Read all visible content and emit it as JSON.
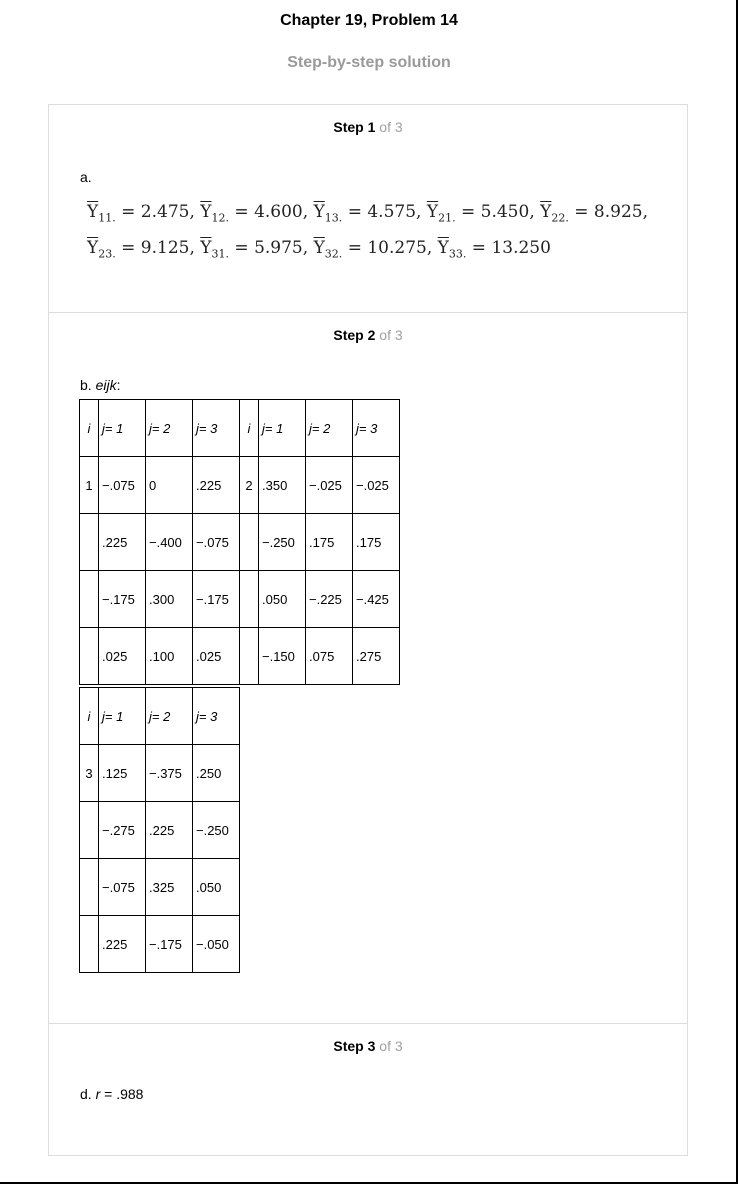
{
  "header": {
    "title": "Chapter 19, Problem 14",
    "subtitle": "Step-by-step solution"
  },
  "steps": [
    {
      "word": "Step",
      "number": "1",
      "of_text": "of 3",
      "part_label": "a.",
      "means": [
        {
          "sub": "11.",
          "value": "2.475"
        },
        {
          "sub": "12.",
          "value": "4.600"
        },
        {
          "sub": "13.",
          "value": "4.575"
        },
        {
          "sub": "21.",
          "value": "5.450"
        },
        {
          "sub": "22.",
          "value": "8.925"
        },
        {
          "sub": "23.",
          "value": "9.125"
        },
        {
          "sub": "31.",
          "value": "5.975"
        },
        {
          "sub": "32.",
          "value": "10.275"
        },
        {
          "sub": "33.",
          "value": "13.250"
        }
      ]
    },
    {
      "word": "Step",
      "number": "2",
      "of_text": "of 3",
      "part_label_prefix": "b. ",
      "part_label_italic": "eijk",
      "part_label_suffix": ":",
      "table_top": {
        "header": [
          "i",
          "j= 1",
          "j= 2",
          "j= 3",
          "i",
          "j= 1",
          "j= 2",
          "j= 3"
        ],
        "rows": [
          [
            "1",
            "−.075",
            "0",
            ".225",
            "2",
            ".350",
            "−.025",
            "−.025"
          ],
          [
            "",
            ".225",
            "−.400",
            "−.075",
            "",
            "−.250",
            ".175",
            ".175"
          ],
          [
            "",
            "−.175",
            ".300",
            "−.175",
            "",
            ".050",
            "−.225",
            "−.425"
          ],
          [
            "",
            ".025",
            ".100",
            ".025",
            "",
            "−.150",
            ".075",
            ".275"
          ]
        ]
      },
      "table_bottom": {
        "header": [
          "i",
          "j= 1",
          "j= 2",
          "j= 3"
        ],
        "rows": [
          [
            "3",
            ".125",
            "−.375",
            ".250"
          ],
          [
            "",
            "−.275",
            ".225",
            "−.250"
          ],
          [
            "",
            "−.075",
            ".325",
            ".050"
          ],
          [
            "",
            ".225",
            "−.175",
            "−.050"
          ]
        ]
      }
    },
    {
      "word": "Step",
      "number": "3",
      "of_text": "of 3",
      "part_label_prefix": "d. ",
      "part_label_italic": "r",
      "part_label_suffix": " = .988"
    }
  ]
}
